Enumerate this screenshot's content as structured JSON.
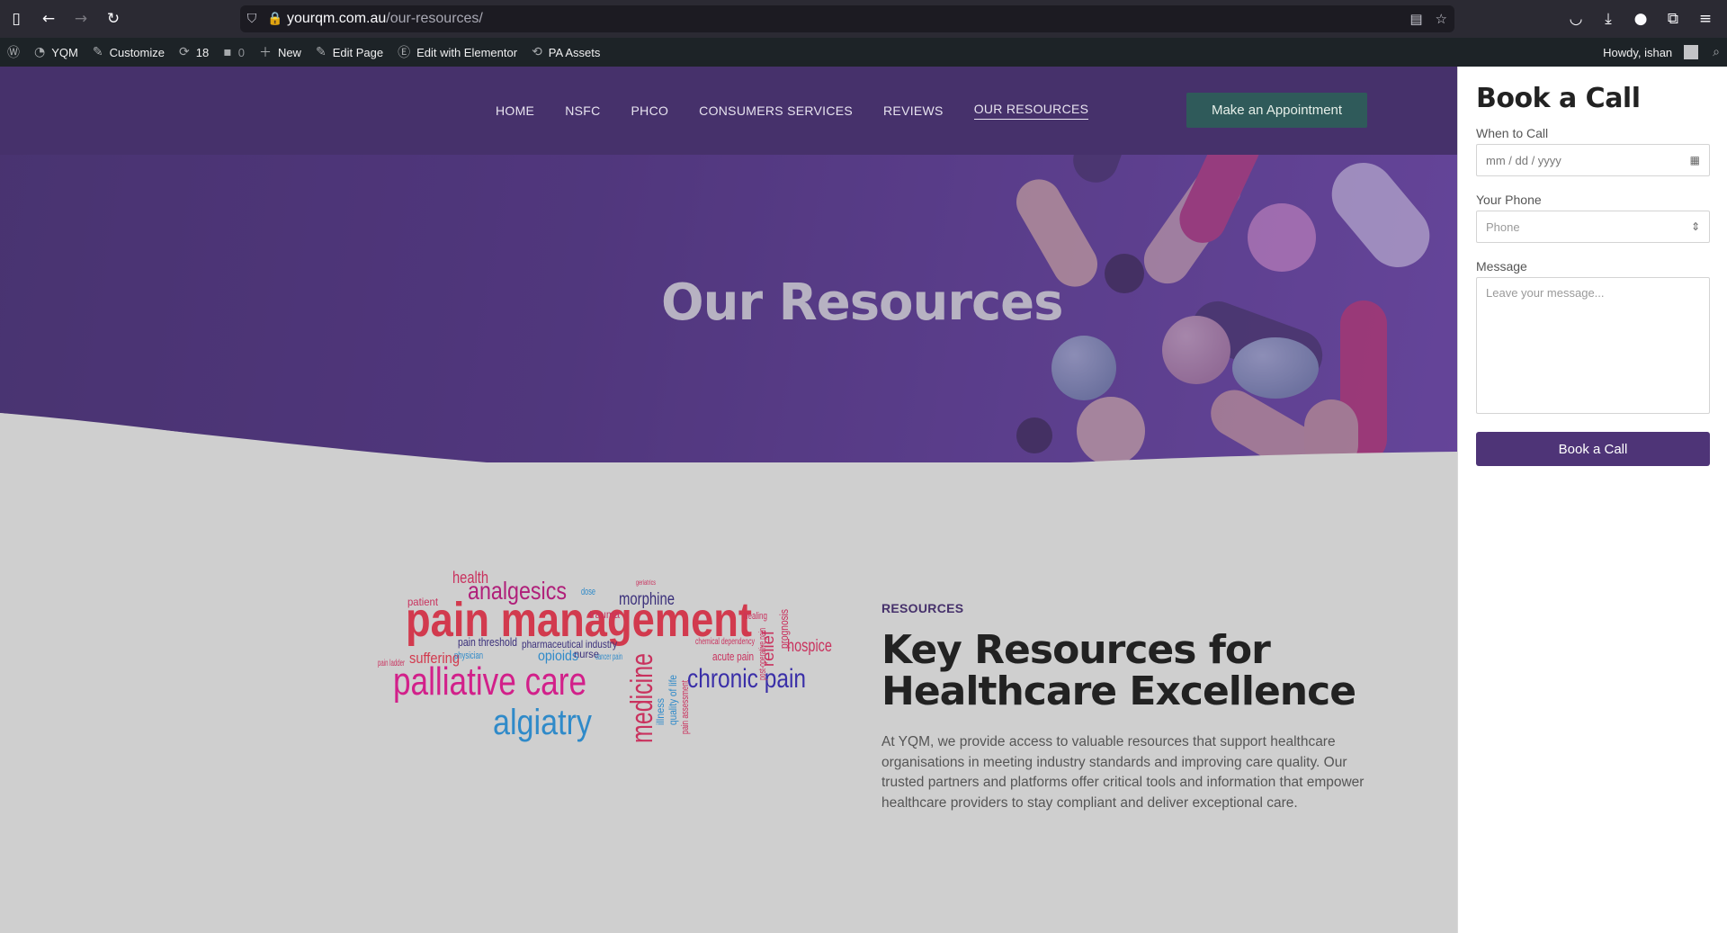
{
  "browser": {
    "url_host": "yourqm.com.au",
    "url_path": "/our-resources/",
    "icons": [
      "sidebar-icon",
      "back-icon",
      "forward-icon",
      "reload-icon",
      "shield-icon",
      "lock-icon",
      "reader-view-icon",
      "bookmark-star-icon",
      "pocket-icon",
      "download-icon",
      "extension-icon",
      "puzzle-icon",
      "menu-icon"
    ]
  },
  "admin_bar": {
    "site_name": "YQM",
    "customize": "Customize",
    "updates_count": "18",
    "comments_count": "0",
    "new": "New",
    "edit_page": "Edit Page",
    "edit_elementor": "Edit with Elementor",
    "pa_assets": "PA Assets",
    "howdy": "Howdy, ishan"
  },
  "nav": {
    "items": [
      "HOME",
      "NSFC",
      "PHCO",
      "CONSUMERS SERVICES",
      "REVIEWS",
      "OUR RESOURCES"
    ],
    "active": "OUR RESOURCES",
    "cta": "Make an Appointment"
  },
  "hero": {
    "title": "Our Resources"
  },
  "section": {
    "label": "RESOURCES",
    "heading": "Key Resources for Healthcare Excellence",
    "paragraph": "At YQM, we provide access to valuable resources that support healthcare organisations in meeting industry standards and improving care quality. Our trusted partners and platforms offer critical tools and information that empower healthcare providers to stay compliant and deliver exceptional care."
  },
  "wordcloud": {
    "words": [
      "pain management",
      "palliative care",
      "chronic pain",
      "algiatry",
      "medicine",
      "analgesics",
      "health",
      "suffering",
      "opioids",
      "morphine",
      "hospice",
      "relief",
      "pain threshold",
      "pharmaceutical industry",
      "nurse",
      "acute pain",
      "trauma",
      "patient",
      "illness",
      "quality of life",
      "pain assessment",
      "prognosis",
      "chemical dependency",
      "healing",
      "cancer pain",
      "pain ladder",
      "physician",
      "dose",
      "geriatrics",
      "post-operative pain"
    ]
  },
  "panel": {
    "title": "Book a Call",
    "when_label": "When to Call",
    "when_placeholder": "mm / dd / yyyy",
    "phone_label": "Your Phone",
    "phone_placeholder": "Phone",
    "message_label": "Message",
    "message_placeholder": "Leave your message...",
    "button": "Book a Call"
  },
  "colors": {
    "brand_purple": "#46316b",
    "cta_green": "#2f5a5a",
    "button_purple": "#4e3477"
  }
}
